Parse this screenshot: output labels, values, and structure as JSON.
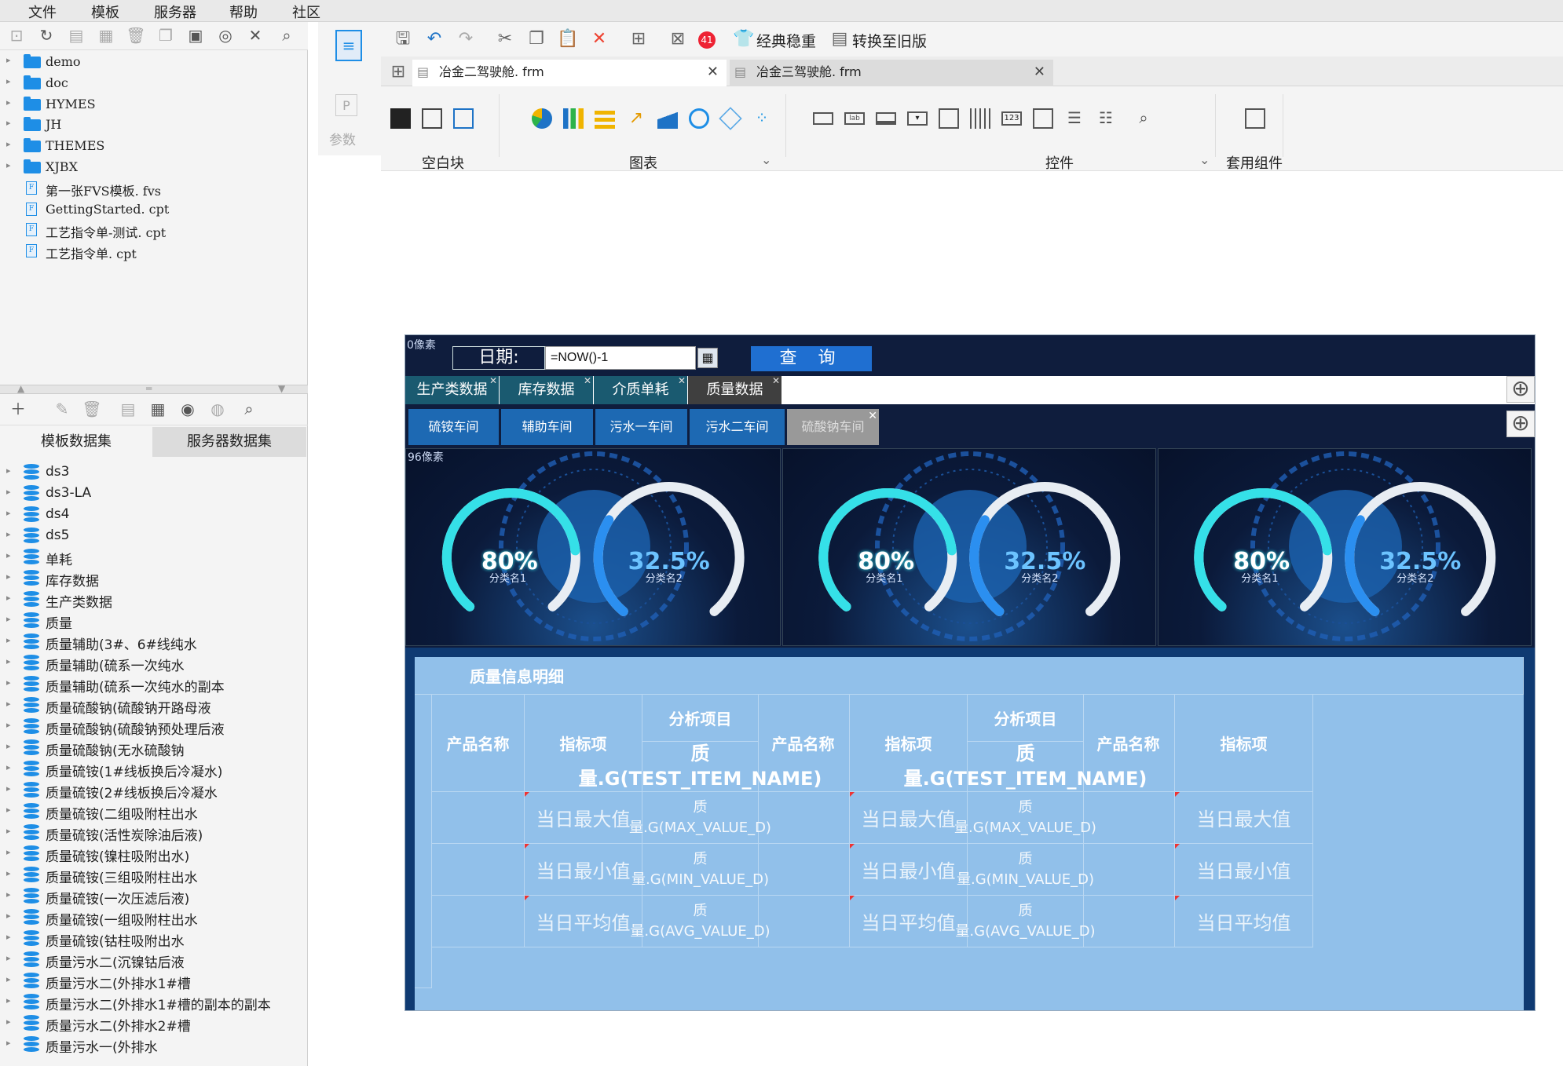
{
  "menu": [
    "文件",
    "模板",
    "服务器",
    "帮助",
    "社区"
  ],
  "file_tree": [
    {
      "name": "demo",
      "type": "folder"
    },
    {
      "name": "doc",
      "type": "folder"
    },
    {
      "name": "HYMES",
      "type": "folder"
    },
    {
      "name": "JH",
      "type": "folder"
    },
    {
      "name": "THEMES",
      "type": "folder"
    },
    {
      "name": "XJBX",
      "type": "folder"
    },
    {
      "name": "第一张FVS模板. fvs",
      "type": "file"
    },
    {
      "name": "GettingStarted. cpt",
      "type": "file"
    },
    {
      "name": "工艺指令单-测试. cpt",
      "type": "file"
    },
    {
      "name": "工艺指令单. cpt",
      "type": "file"
    }
  ],
  "dataset_tabs": [
    "模板数据集",
    "服务器数据集"
  ],
  "datasets": [
    "ds3",
    "ds3-LA",
    "ds4",
    "ds5",
    "单耗",
    "库存数据",
    "生产类数据",
    "质量",
    "质量辅助(3#、6#线纯水",
    "质量辅助(硫系一次纯水",
    "质量辅助(硫系一次纯水的副本",
    "质量硫酸钠(硫酸钠开路母液",
    "质量硫酸钠(硫酸钠预处理后液",
    "质量硫酸钠(无水硫酸钠",
    "质量硫铵(1#线板换后冷凝水)",
    "质量硫铵(2#线板换后冷凝水",
    "质量硫铵(二组吸附柱出水",
    "质量硫铵(活性炭除油后液)",
    "质量硫铵(镍柱吸附出水)",
    "质量硫铵(三组吸附柱出水",
    "质量硫铵(一次压滤后液)",
    "质量硫铵(一组吸附柱出水",
    "质量硫铵(钴柱吸附出水",
    "质量污水二(沉镍钴后液",
    "质量污水二(外排水1#槽",
    "质量污水二(外排水1#槽的副本的副本",
    "质量污水二(外排水2#槽",
    "质量污水一(外排水"
  ],
  "toolbar": {
    "classic_btn": "经典稳重",
    "convert_btn": "转换至旧版",
    "badge": "41"
  },
  "doc_tabs": [
    {
      "name": "冶金二驾驶舱. frm"
    },
    {
      "name": "冶金三驾驶舱. frm"
    }
  ],
  "side": {
    "param_label": "参数"
  },
  "component_groups": {
    "blank": "空白块",
    "chart": "图表",
    "widget": "控件",
    "preset": "套用组件"
  },
  "report": {
    "px_label_top": "0像素",
    "date_label": "日期:",
    "date_value": "=NOW()-1",
    "query_label": "查 询",
    "tabs_level1": [
      {
        "label": "生产类数据",
        "selected": false
      },
      {
        "label": "库存数据",
        "selected": false
      },
      {
        "label": "介质单耗",
        "selected": false
      },
      {
        "label": "质量数据",
        "selected": true
      }
    ],
    "tabs_level2": [
      {
        "label": "硫铵车间",
        "enabled": true
      },
      {
        "label": "辅助车间",
        "enabled": true
      },
      {
        "label": "污水一车间",
        "enabled": true
      },
      {
        "label": "污水二车间",
        "enabled": true
      },
      {
        "label": "硫酸钠车间",
        "enabled": false
      }
    ],
    "px_label_gauges": "96像素",
    "gauges": [
      {
        "value1": "80%",
        "cat1": "分类名1",
        "value2": "32.5%",
        "cat2": "分类名2"
      },
      {
        "value1": "80%",
        "cat1": "分类名1",
        "value2": "32.5%",
        "cat2": "分类名2"
      },
      {
        "value1": "80%",
        "cat1": "分类名1",
        "value2": "32.5%",
        "cat2": "分类名2"
      }
    ],
    "table_title": "质量信息明细",
    "col_product": "产品名称",
    "col_metric": "指标项",
    "col_analysis": "分析项目",
    "field_item": "质量.G(TEST_ITEM_NAME)",
    "rows": [
      {
        "label": "当日最大值",
        "formula": "质量.G(MAX_VALUE_D)"
      },
      {
        "label": "当日最小值",
        "formula": "质量.G(MIN_VALUE_D)"
      },
      {
        "label": "当日平均值",
        "formula": "质量.G(AVG_VALUE_D)"
      }
    ]
  },
  "colors": {
    "canvas_bg": "#0f1d3d",
    "tab_active": "#1d69b3",
    "table_bg": "#91c0ea",
    "gauge_cyan": "#35e0e8"
  }
}
